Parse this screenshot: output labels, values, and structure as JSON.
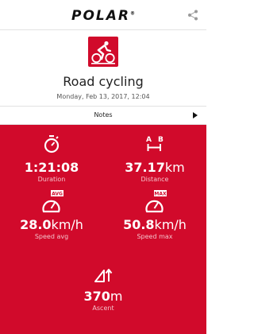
{
  "header": {
    "logo_text": "POLAR",
    "logo_reg": "®"
  },
  "summary": {
    "sport": "Road cycling",
    "date": "Monday, Feb 13, 2017, 12:04"
  },
  "notes": {
    "label": "Notes"
  },
  "stats": {
    "duration": {
      "value": "1:21:08",
      "unit": "",
      "label": "Duration"
    },
    "distance": {
      "value": "37.17",
      "unit": "km",
      "label": "Distance",
      "icon_a": "A",
      "icon_b": "B"
    },
    "speed_avg": {
      "value": "28.0",
      "unit": "km/h",
      "label": "Speed avg",
      "badge": "AVG"
    },
    "speed_max": {
      "value": "50.8",
      "unit": "km/h",
      "label": "Speed max",
      "badge": "MAX"
    },
    "ascent": {
      "value": "370",
      "unit": "m",
      "label": "Ascent"
    }
  },
  "colors": {
    "brand_red": "#d10a2b",
    "label_pink": "#f4c2ca"
  }
}
